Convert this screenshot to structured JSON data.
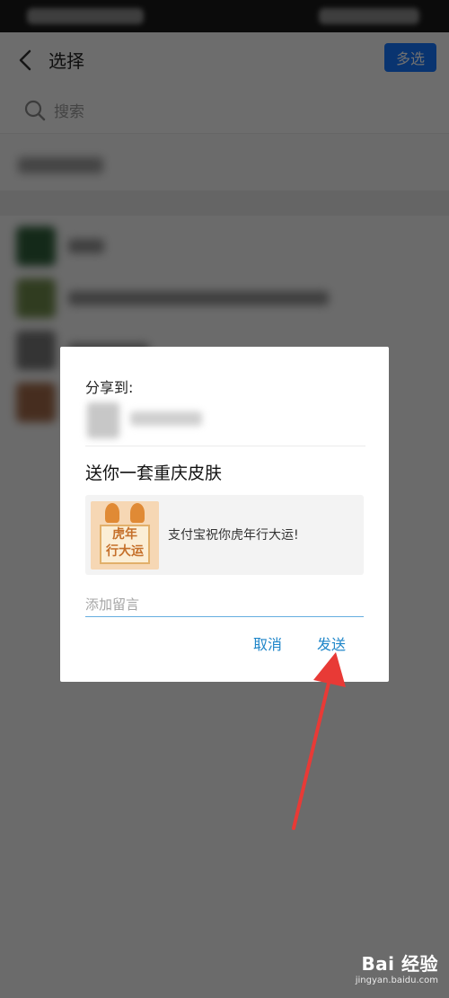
{
  "header": {
    "title": "选择",
    "multi_select_label": "多选"
  },
  "search": {
    "placeholder": "搜索"
  },
  "dialog": {
    "share_label": "分享到:",
    "title": "送你一套重庆皮肤",
    "card": {
      "thumb_lines": [
        "虎年",
        "行大运"
      ],
      "text": "支付宝祝你虎年行大运!"
    },
    "message_placeholder": "添加留言",
    "cancel_label": "取消",
    "send_label": "发送"
  },
  "watermark": {
    "logo": "Bai 经验",
    "url": "jingyan.baidu.com"
  },
  "colors": {
    "accent": "#1677ff",
    "link": "#1f86c9",
    "arrow": "#e83a36"
  }
}
